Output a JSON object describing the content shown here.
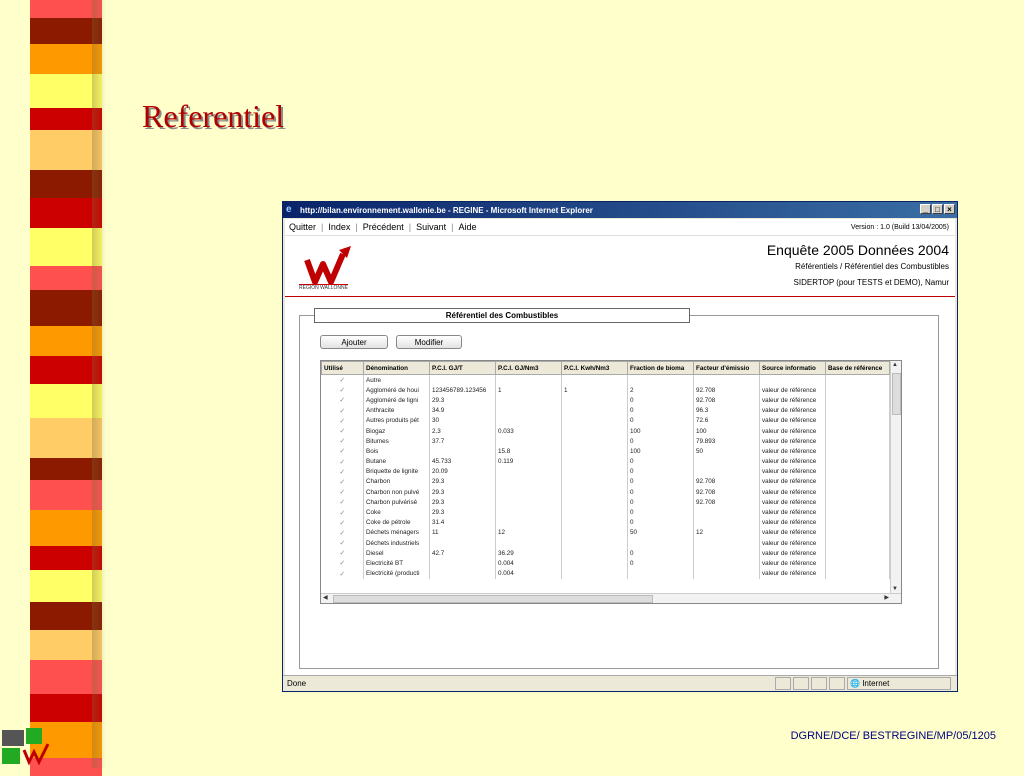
{
  "slide": {
    "title": "Referentiel",
    "footer": "DGRNE/DCE/ BESTREGINE/MP/05/1205"
  },
  "colors": {
    "background": "#ffffcc",
    "title": "#b00000",
    "stripe": [
      "#ff5050",
      "#8b1a00",
      "#ff9900",
      "#ffff66",
      "#cc0000",
      "#ffcc66"
    ]
  },
  "browser": {
    "title": "http://bilan.environnement.wallonie.be - REGINE - Microsoft Internet Explorer",
    "status": "Done",
    "zone": "Internet"
  },
  "menu": {
    "items": [
      "Quitter",
      "Index",
      "Précédent",
      "Suivant",
      "Aide"
    ],
    "version": "Version : 1.0 (Build 13/04/2005)"
  },
  "header": {
    "region_label": "RÉGION WALLONNE",
    "title": "Enquête 2005 Données 2004",
    "subtitle": "Référentiels / Référentiel des Combustibles",
    "user": "SIDERTOP (pour TESTS et DEMO), Namur"
  },
  "section": {
    "title": "Référentiel des Combustibles",
    "add_label": "Ajouter",
    "edit_label": "Modifier"
  },
  "grid": {
    "columns": [
      "Utilisé",
      "Dénomination",
      "P.C.I. GJ/T",
      "P.C.I. GJ/Nm3",
      "P.C.I. Kwh/Nm3",
      "Fraction de bioma",
      "Facteur d'émissio",
      "Source informatio",
      "Base de référence"
    ],
    "rows": [
      [
        "✓",
        "Autre",
        "",
        "",
        "",
        "",
        "",
        "",
        ""
      ],
      [
        "✓",
        "Aggloméré de houi",
        "123456789.123456",
        "1",
        "1",
        "2",
        "92.708",
        "valeur de référence",
        ""
      ],
      [
        "✓",
        "Aggloméré de ligni",
        "29.3",
        "",
        "",
        "0",
        "92.708",
        "valeur de référence",
        ""
      ],
      [
        "✓",
        "Anthracite",
        "34.9",
        "",
        "",
        "0",
        "96.3",
        "valeur de référence",
        ""
      ],
      [
        "✓",
        "Autres produits pét",
        "30",
        "",
        "",
        "0",
        "72.6",
        "valeur de référence",
        ""
      ],
      [
        "✓",
        "Biogaz",
        "2.3",
        "0.033",
        "",
        "100",
        "100",
        "valeur de référence",
        ""
      ],
      [
        "✓",
        "Bitumes",
        "37.7",
        "",
        "",
        "0",
        "79.893",
        "valeur de référence",
        ""
      ],
      [
        "✓",
        "Bois",
        "",
        "15.8",
        "",
        "100",
        "50",
        "valeur de référence",
        ""
      ],
      [
        "✓",
        "Butane",
        "45.733",
        "0.119",
        "",
        "0",
        "",
        "valeur de référence",
        ""
      ],
      [
        "✓",
        "Briquette de lignite",
        "20.09",
        "",
        "",
        "0",
        "",
        "valeur de référence",
        ""
      ],
      [
        "✓",
        "Charbon",
        "29.3",
        "",
        "",
        "0",
        "92.708",
        "valeur de référence",
        ""
      ],
      [
        "✓",
        "Charbon non pulvé",
        "29.3",
        "",
        "",
        "0",
        "92.708",
        "valeur de référence",
        ""
      ],
      [
        "✓",
        "Charbon pulvérisé",
        "29.3",
        "",
        "",
        "0",
        "92.708",
        "valeur de référence",
        ""
      ],
      [
        "✓",
        "Coke",
        "29.3",
        "",
        "",
        "0",
        "",
        "valeur de référence",
        ""
      ],
      [
        "✓",
        "Coke de pétrole",
        "31.4",
        "",
        "",
        "0",
        "",
        "valeur de référence",
        ""
      ],
      [
        "✓",
        "Déchets ménagers",
        "11",
        "12",
        "",
        "50",
        "12",
        "valeur de référence",
        ""
      ],
      [
        "✓",
        "Déchets industriels",
        "",
        "",
        "",
        "",
        "",
        "valeur de référence",
        ""
      ],
      [
        "✓",
        "Diesel",
        "42.7",
        "36.29",
        "",
        "0",
        "",
        "valeur de référence",
        ""
      ],
      [
        "✓",
        "Electricité BT",
        "",
        "0.004",
        "",
        "0",
        "",
        "valeur de référence",
        ""
      ],
      [
        "✓",
        "Electricité (producti",
        "",
        "0.004",
        "",
        "",
        "",
        "valeur de référence",
        ""
      ]
    ]
  }
}
